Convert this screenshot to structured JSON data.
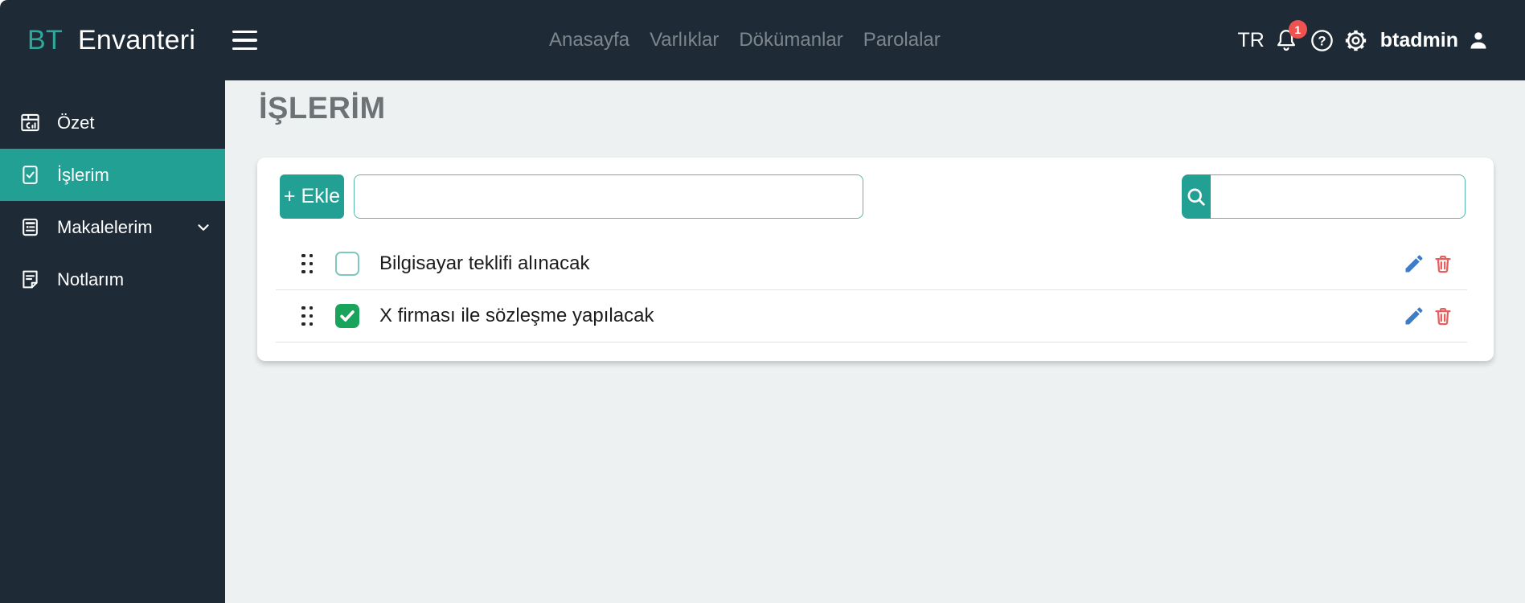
{
  "topbar": {
    "logo": {
      "primary": "BT",
      "secondary": "Envanteri"
    },
    "nav": [
      {
        "label": "Anasayfa"
      },
      {
        "label": "Varlıklar"
      },
      {
        "label": "Dökümanlar"
      },
      {
        "label": "Parolalar"
      }
    ],
    "right": {
      "locale": "TR",
      "notification_count": "1",
      "username": "btadmin",
      "icons": [
        "bell-icon",
        "help-icon",
        "gear-icon",
        "user-icon"
      ]
    }
  },
  "sidebar": {
    "items": [
      {
        "label": "Özet",
        "icon": "dashboard-icon",
        "active": false
      },
      {
        "label": "İşlerim",
        "icon": "tasks-icon",
        "active": true
      },
      {
        "label": "Makalelerim",
        "icon": "articles-icon",
        "active": false,
        "has_submenu": true
      },
      {
        "label": "Notlarım",
        "icon": "notes-icon",
        "active": false
      }
    ]
  },
  "main": {
    "title": "İŞLERİM",
    "toolbar": {
      "add_button_label": "+ Ekle",
      "new_task_value": "",
      "search_value": ""
    },
    "tasks": [
      {
        "label": "Bilgisayar teklifi alınacak",
        "checked": false
      },
      {
        "label": "X firması ile sözleşme yapılacak",
        "checked": true
      }
    ]
  },
  "colors": {
    "topbar_bg": "#1e2a36",
    "accent_teal": "#21a093",
    "input_border_teal": "#57b8ae",
    "checked_green": "#18a45a",
    "edit_blue": "#3d7dc8",
    "delete_red": "#e4605f",
    "badge_red": "#ef5350",
    "page_bg": "#eef1f2",
    "title_gray": "#6d7275",
    "nav_gray": "#7e868d"
  }
}
